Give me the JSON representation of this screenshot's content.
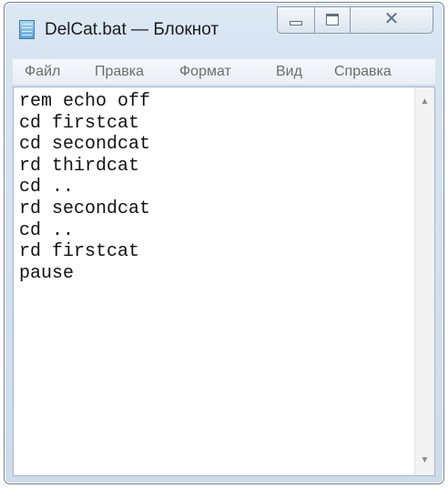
{
  "window": {
    "title": "DelCat.bat — Блокнот",
    "icon": "notepad-icon",
    "controls": {
      "minimize": "minimize-icon",
      "maximize": "maximize-icon",
      "close_glyph": "✕"
    }
  },
  "menu": {
    "items": [
      {
        "label": "Файл"
      },
      {
        "label": "Правка"
      },
      {
        "label": "Формат"
      },
      {
        "label": "Вид"
      },
      {
        "label": "Справка"
      }
    ]
  },
  "editor": {
    "lines": [
      "rem echo off",
      "cd firstcat",
      "cd secondcat",
      "rd thirdcat",
      "cd ..",
      "rd secondcat",
      "cd ..",
      "rd firstcat",
      "pause"
    ]
  },
  "scrollbar": {
    "up_glyph": "▲",
    "down_glyph": "▼"
  }
}
